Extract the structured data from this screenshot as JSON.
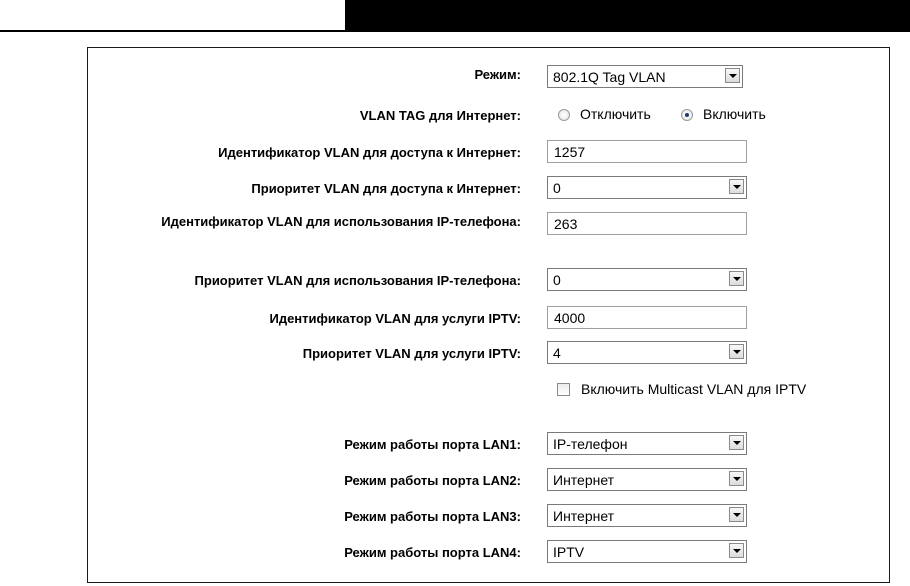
{
  "form": {
    "mode_label": "Режим:",
    "mode_value": "802.1Q Tag VLAN",
    "vlan_tag_label": "VLAN TAG для Интернет:",
    "vlan_tag_option_off": "Отключить",
    "vlan_tag_option_on": "Включить",
    "vlan_tag_selected": "Включить",
    "internet_vlan_id_label": "Идентификатор VLAN для доступа к Интернет:",
    "internet_vlan_id_value": "1257",
    "internet_vlan_priority_label": "Приоритет VLAN для доступа к Интернет:",
    "internet_vlan_priority_value": "0",
    "ipphone_vlan_id_label": "Идентификатор VLAN для использования IP-телефона:",
    "ipphone_vlan_id_value": "263",
    "ipphone_vlan_priority_label": "Приоритет VLAN для использования IP-телефона:",
    "ipphone_vlan_priority_value": "0",
    "iptv_vlan_id_label": "Идентификатор VLAN для услуги IPTV:",
    "iptv_vlan_id_value": "4000",
    "iptv_vlan_priority_label": "Приоритет VLAN для услуги IPTV:",
    "iptv_vlan_priority_value": "4",
    "multicast_label": "Включить Multicast VLAN для IPTV",
    "multicast_checked": false,
    "lan_ports": [
      {
        "label": "Режим работы порта LAN1:",
        "value": "IP-телефон"
      },
      {
        "label": "Режим работы порта LAN2:",
        "value": "Интернет"
      },
      {
        "label": "Режим работы порта LAN3:",
        "value": "Интернет"
      },
      {
        "label": "Режим работы порта LAN4:",
        "value": "IPTV"
      }
    ]
  }
}
